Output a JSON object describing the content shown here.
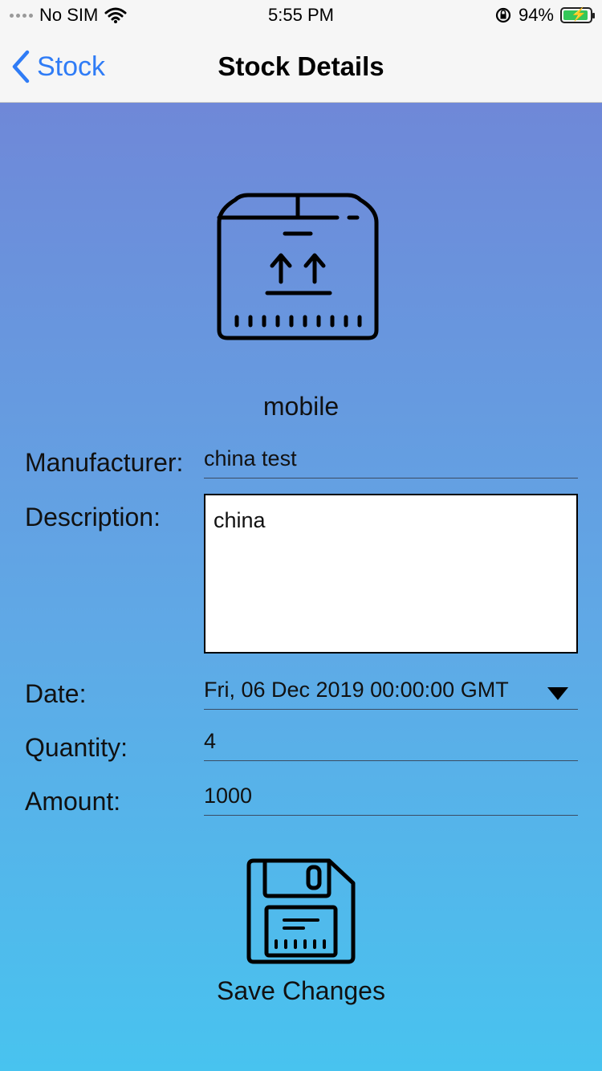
{
  "status_bar": {
    "carrier": "No SIM",
    "time": "5:55 PM",
    "battery": "94%",
    "battery_level": 0.94
  },
  "nav": {
    "back_label": "Stock",
    "title": "Stock Details"
  },
  "product": {
    "name": "mobile"
  },
  "form": {
    "manufacturer_label": "Manufacturer:",
    "manufacturer_value": "china test",
    "description_label": "Description:",
    "description_value": "china",
    "date_label": "Date:",
    "date_value": "Fri, 06 Dec 2019 00:00:00 GMT",
    "quantity_label": "Quantity:",
    "quantity_value": "4",
    "amount_label": "Amount:",
    "amount_value": "1000"
  },
  "save": {
    "label": "Save Changes"
  },
  "colors": {
    "accent": "#2f7cf6",
    "gradient_top": "#6f88d8",
    "gradient_bottom": "#48c3ef",
    "battery_fill": "#34c759"
  },
  "icons": {
    "wifi": "wifi-icon",
    "lock_rotation": "orientation-lock-icon",
    "battery": "battery-icon",
    "back": "chevron-left-icon",
    "product": "package-box-icon",
    "dropdown": "triangle-down-icon",
    "save": "floppy-disk-icon"
  }
}
